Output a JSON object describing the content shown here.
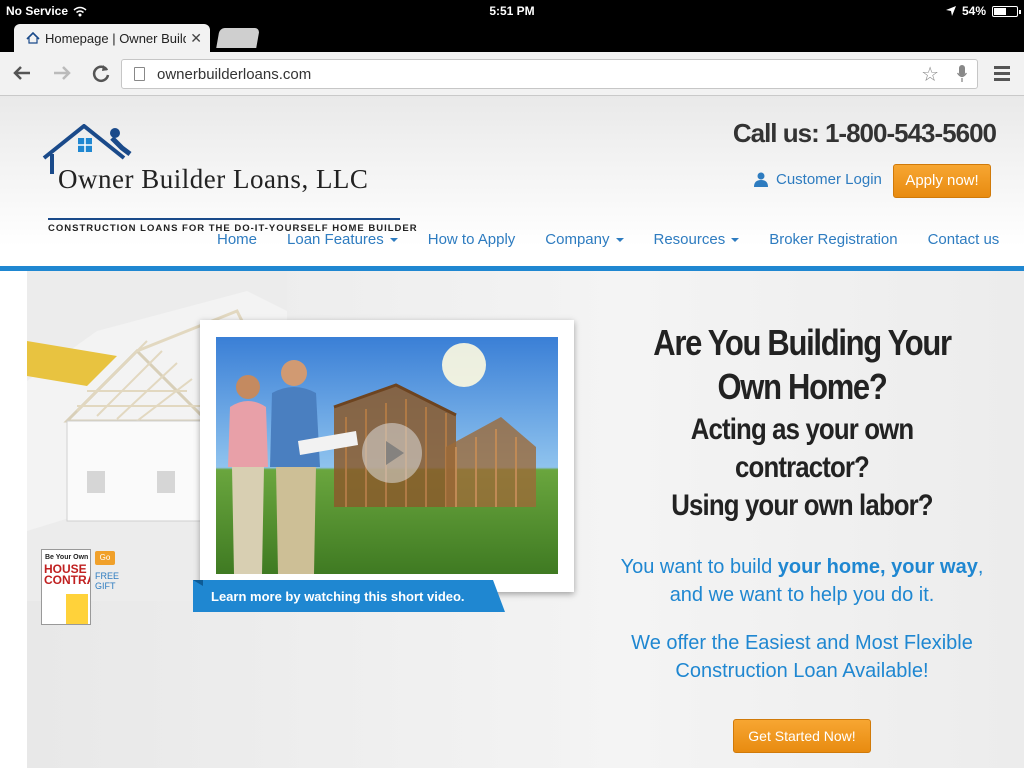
{
  "status_bar": {
    "carrier": "No Service",
    "time": "5:51 PM",
    "battery": "54%",
    "battery_level": 0.54
  },
  "browser": {
    "tab_title": "Homepage | Owner Builde",
    "url": "ownerbuilderloans.com"
  },
  "header": {
    "logo_name": "Owner Builder Loans, LLC",
    "logo_tagline": "CONSTRUCTION LOANS FOR THE DO-IT-YOURSELF HOME BUILDER",
    "phone": "Call us: 1-800-543-5600",
    "login_label": "Customer Login",
    "apply_label": "Apply now!"
  },
  "nav": {
    "items": [
      {
        "label": "Home",
        "dropdown": false
      },
      {
        "label": "Loan Features",
        "dropdown": true
      },
      {
        "label": "How to Apply",
        "dropdown": false
      },
      {
        "label": "Company",
        "dropdown": true
      },
      {
        "label": "Resources",
        "dropdown": true
      },
      {
        "label": "Broker Registration",
        "dropdown": false
      },
      {
        "label": "Contact us",
        "dropdown": false
      }
    ]
  },
  "hero": {
    "video_caption": "Learn more by watching this short video.",
    "gift_book_title_top": "Be Your Own",
    "gift_book_title_1": "HOUSE",
    "gift_book_title_2": "CONTRACTOR",
    "gift_go": "Go",
    "gift_label": "FREE GIFT",
    "headline_1": "Are You Building Your Own Home?",
    "headline_2a": "Acting as your own contractor?",
    "headline_2b": "Using your own labor?",
    "sub_1_prefix": "You want to build ",
    "sub_1_bold": "your home, your way",
    "sub_1_suffix": ", and we want to help you do it.",
    "sub_2": "We offer the Easiest and Most Flexible Construction Loan Available!",
    "cta_label": "Get Started Now!"
  },
  "colors": {
    "accent_blue": "#1f87d1",
    "link_blue": "#2e7cc0",
    "button_orange": "#f0961e",
    "headline_dark": "#222222"
  }
}
